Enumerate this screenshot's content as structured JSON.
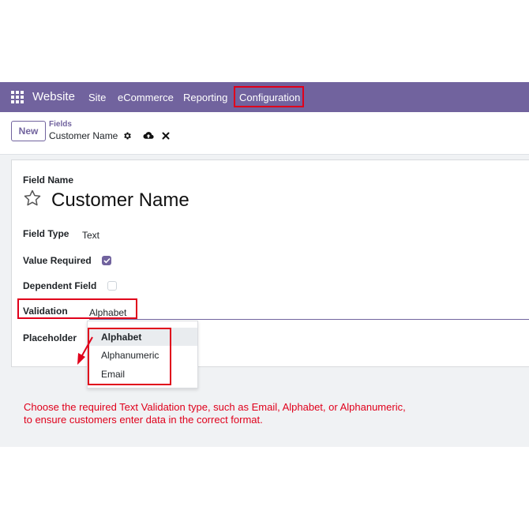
{
  "navbar": {
    "brand": "Website",
    "items": [
      "Site",
      "eCommerce",
      "Reporting",
      "Configuration"
    ]
  },
  "control": {
    "new_label": "New",
    "breadcrumb_parent": "Fields",
    "breadcrumb_current": "Customer Name"
  },
  "form": {
    "field_name_label": "Field Name",
    "field_name_value": "Customer Name",
    "field_type_label": "Field Type",
    "field_type_value": "Text",
    "value_required_label": "Value Required",
    "value_required_checked": true,
    "dependent_field_label": "Dependent Field",
    "dependent_field_checked": false,
    "validation_label": "Validation",
    "validation_value": "Alphabet",
    "placeholder_label": "Placeholder"
  },
  "dropdown": {
    "options": [
      "Alphabet",
      "Alphanumeric",
      "Email"
    ],
    "selected": "Alphabet"
  },
  "annotation": {
    "line1": "Choose the required Text Validation type, such as Email, Alphabet, or Alphanumeric,",
    "line2": "to ensure customers enter data in the correct format."
  },
  "colors": {
    "navbar": "#71639e",
    "accent": "#71639e",
    "highlight": "#e0001b"
  }
}
